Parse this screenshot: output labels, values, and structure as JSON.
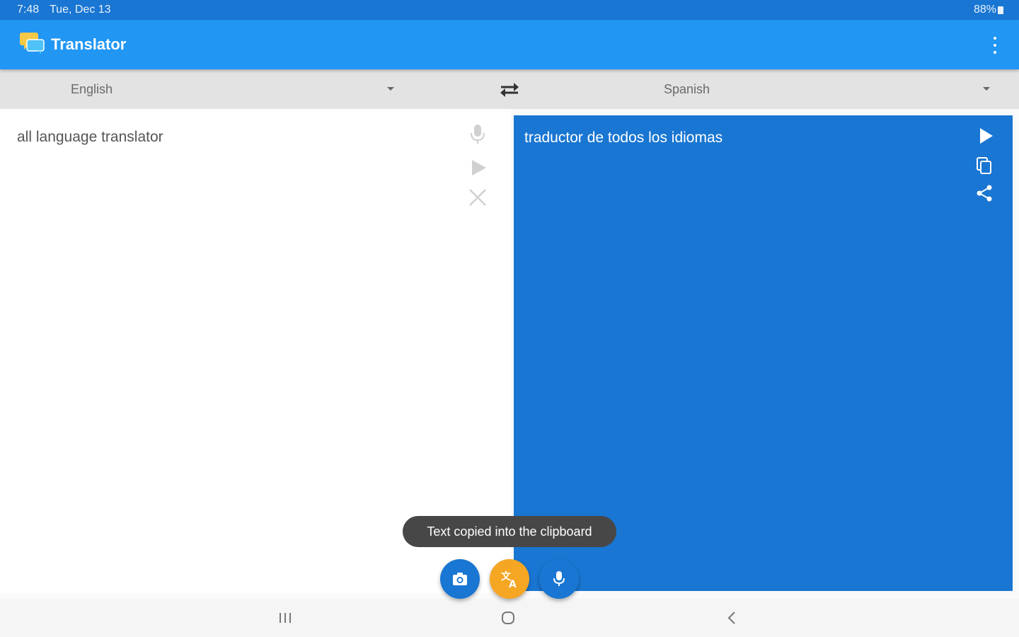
{
  "status_bar": {
    "time": "7:48",
    "date": "Tue, Dec 13",
    "battery": "88%"
  },
  "app_bar": {
    "title": "Translator",
    "menu_icon": "more-vert-icon"
  },
  "languages": {
    "source": "English",
    "target": "Spanish",
    "swap_icon": "swap-horiz-icon"
  },
  "source_panel": {
    "text": "all language translator",
    "icons": [
      "mic-icon",
      "play-icon",
      "close-icon"
    ]
  },
  "target_panel": {
    "text": "traductor de todos los idiomas",
    "icons": [
      "play-icon",
      "copy-icon",
      "share-icon"
    ]
  },
  "toast": {
    "message": "Text copied into the clipboard"
  },
  "fabs": [
    "camera-icon",
    "translate-icon",
    "mic-icon"
  ],
  "nav_bar": [
    "recents-icon",
    "home-icon",
    "back-icon"
  ],
  "colors": {
    "status_bar": "#1976d2",
    "app_bar": "#2196f3",
    "target_panel": "#1976d2",
    "translate_fab": "#f5a623",
    "toast": "#474747"
  }
}
